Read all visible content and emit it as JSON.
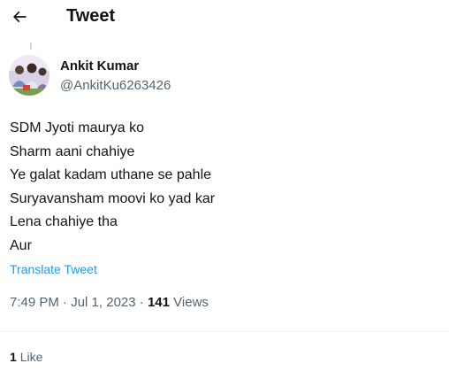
{
  "header": {
    "back_icon": "arrow-left-icon",
    "title": "Tweet"
  },
  "author": {
    "display_name": "Ankit Kumar",
    "handle": "@AnkitKu6263426"
  },
  "tweet": {
    "lines": [
      "SDM Jyoti maurya ko",
      "Sharm aani chahiye",
      "Ye galat kadam uthane se pahle",
      "Suryavansham moovi ko yad kar",
      "Lena chahiye tha",
      "Aur"
    ],
    "translate_label": "Translate Tweet"
  },
  "meta": {
    "time": "7:49 PM",
    "separator": "·",
    "date": "Jul 1, 2023",
    "views_count": "141",
    "views_label": "Views"
  },
  "stats": {
    "likes_count": "1",
    "likes_label": "Like"
  },
  "colors": {
    "text": "#0f1419",
    "secondary": "#536471",
    "link": "#1d9bf0",
    "divider": "#eff3f4"
  }
}
